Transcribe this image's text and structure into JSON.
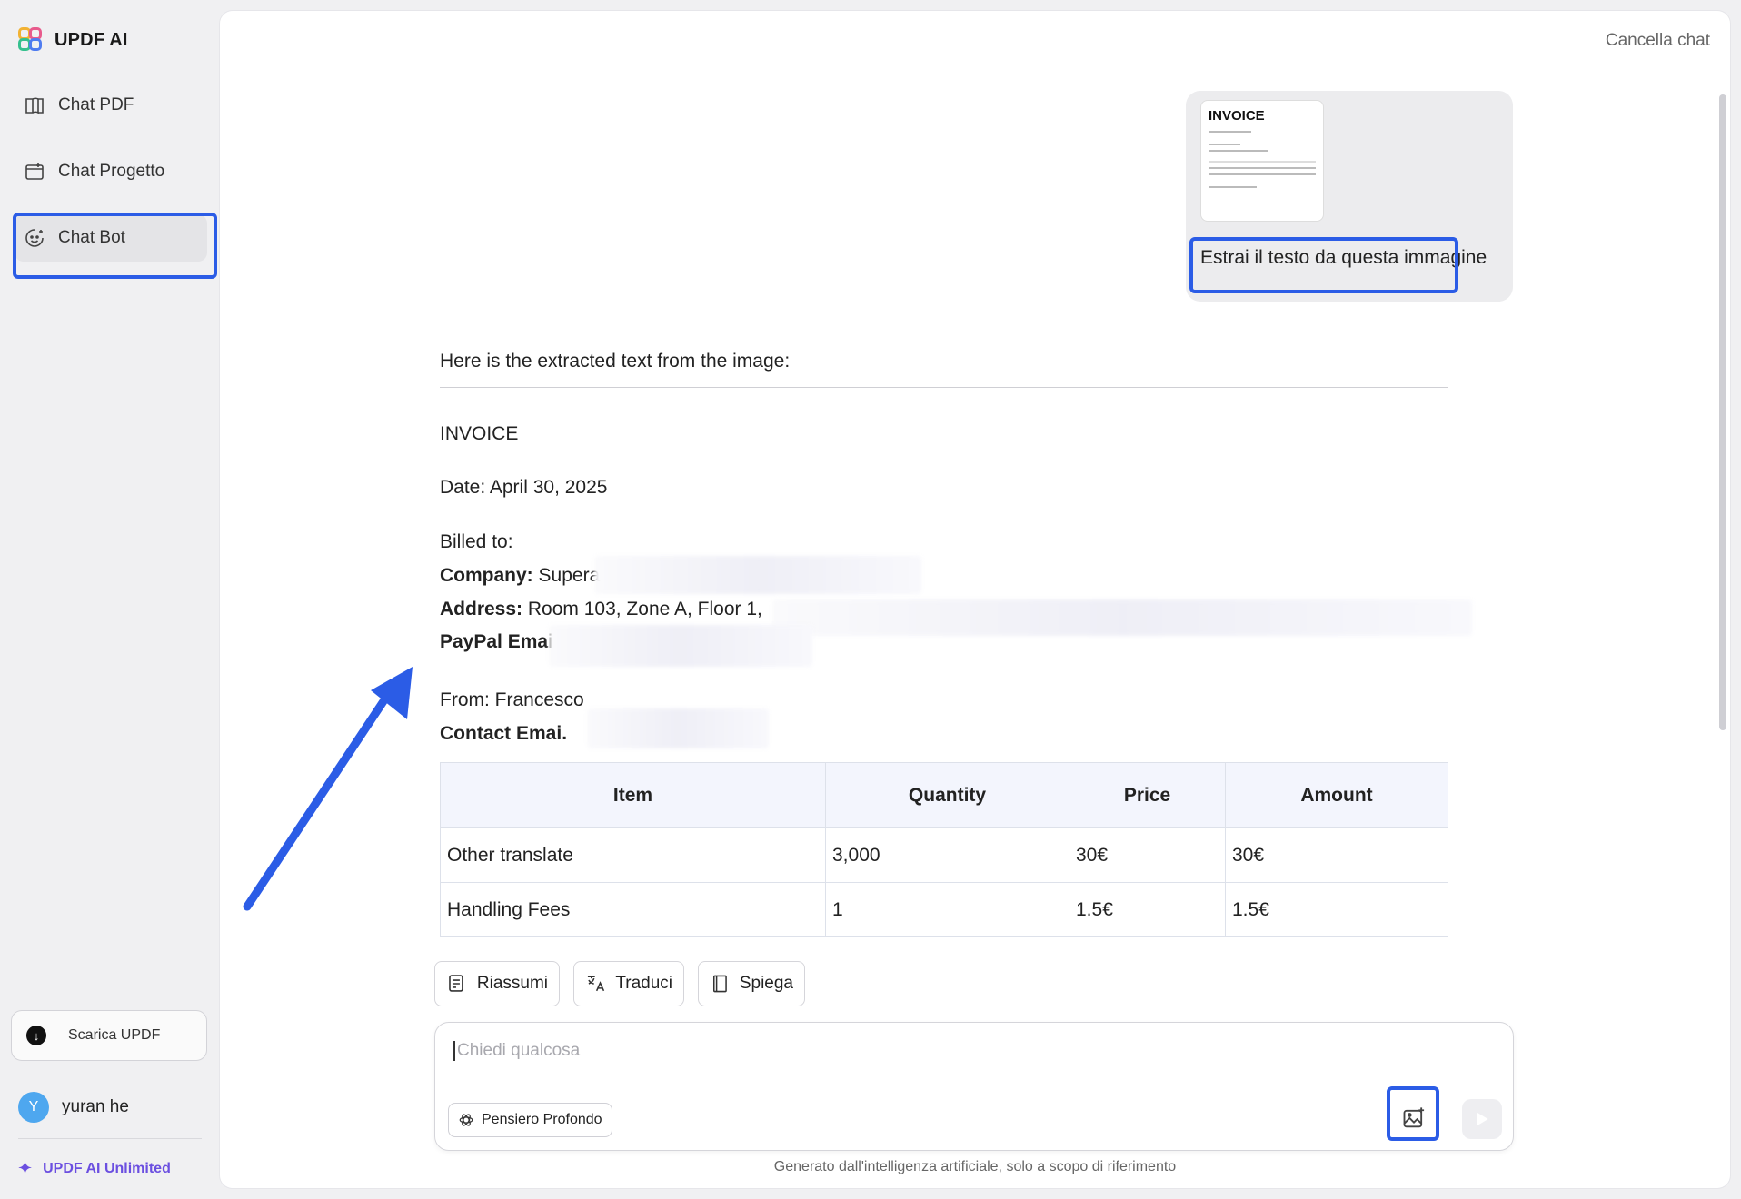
{
  "app": {
    "name": "UPDF AI"
  },
  "sidebar": {
    "items": [
      {
        "label": "Chat PDF",
        "icon": "book-icon"
      },
      {
        "label": "Chat Progetto",
        "icon": "folder-icon"
      },
      {
        "label": "Chat Bot",
        "icon": "bot-icon",
        "active": true
      }
    ],
    "download_label": "Scarica UPDF",
    "user": {
      "initial": "Y",
      "name": "yuran he"
    },
    "plan_label": "UPDF AI Unlimited"
  },
  "header": {
    "clear_chat": "Cancella chat"
  },
  "user_message": {
    "thumbnail_title": "INVOICE",
    "text": "Estrai il testo da questa immagine"
  },
  "answer": {
    "intro": "Here is the extracted text from the image:",
    "doc_title": "INVOICE",
    "date": "Date: April 30, 2025",
    "billed_to": "Billed to:",
    "company_label": "Company:",
    "company_value": "Supera",
    "address_label": "Address:",
    "address_value": "Room 103, Zone A, Floor 1,",
    "paypal_label": "PayPal Emai",
    "from": "From: Francesco",
    "contact_label": "Contact Emai."
  },
  "table": {
    "headers": [
      "Item",
      "Quantity",
      "Price",
      "Amount"
    ],
    "rows": [
      [
        "Other translate",
        "3,000",
        "30€",
        "30€"
      ],
      [
        "Handling Fees",
        "1",
        "1.5€",
        "1.5€"
      ]
    ]
  },
  "actions": {
    "summarize": "Riassumi",
    "translate": "Traduci",
    "explain": "Spiega"
  },
  "composer": {
    "placeholder": "Chiedi qualcosa",
    "deep_thinking": "Pensiero Profondo"
  },
  "footer_note": "Generato dall'intelligenza artificiale, solo a scopo di riferimento",
  "colors": {
    "highlight": "#2b5ce6",
    "accent_purple": "#6b4fe0",
    "avatar": "#4ea7ef"
  }
}
